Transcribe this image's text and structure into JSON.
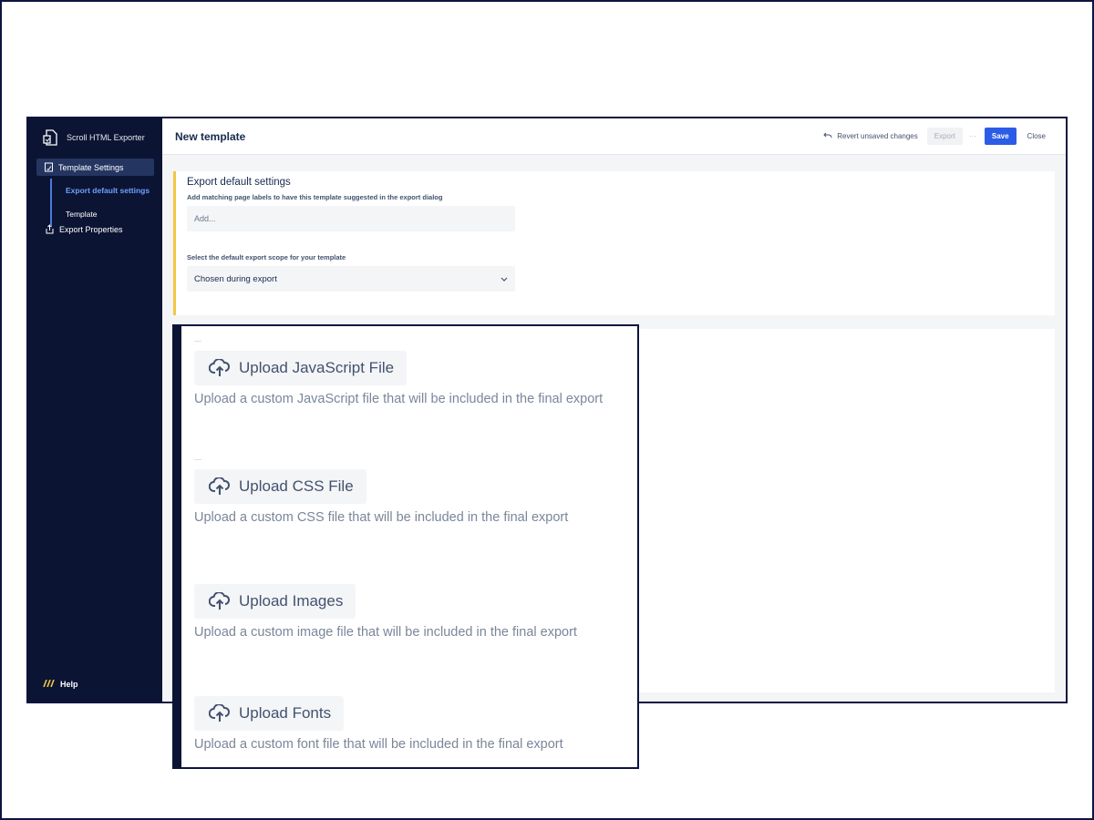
{
  "sidebar": {
    "app_name": "Scroll HTML Exporter",
    "items": [
      {
        "label": "Template Settings"
      },
      {
        "label": "Export Properties"
      }
    ],
    "subitems": [
      {
        "label": "Export default settings"
      },
      {
        "label": "Template"
      }
    ],
    "help_label": "Help"
  },
  "topbar": {
    "title": "New template",
    "revert_label": "Revert unsaved changes",
    "export_label": "Export",
    "more_label": "···",
    "save_label": "Save",
    "close_label": "Close"
  },
  "settings": {
    "title": "Export default settings",
    "labels_field_label": "Add matching page labels to have this template suggested in the export dialog",
    "labels_placeholder": "Add...",
    "scope_field_label": "Select the default export scope for your template",
    "scope_value": "Chosen during export"
  },
  "uploads": [
    {
      "button": "Upload JavaScript File",
      "desc": "Upload a custom JavaScript file that will be included in the final export"
    },
    {
      "button": "Upload CSS File",
      "desc": "Upload a custom CSS file that will be included in the final export"
    },
    {
      "button": "Upload Images",
      "desc": "Upload a custom image file that will be included in the final export"
    },
    {
      "button": "Upload Fonts",
      "desc": "Upload a custom font file that will be included in the final export"
    }
  ],
  "colors": {
    "accent": "#2c5ce6",
    "sidebar": "#0b1433",
    "highlight": "#f2c744"
  }
}
